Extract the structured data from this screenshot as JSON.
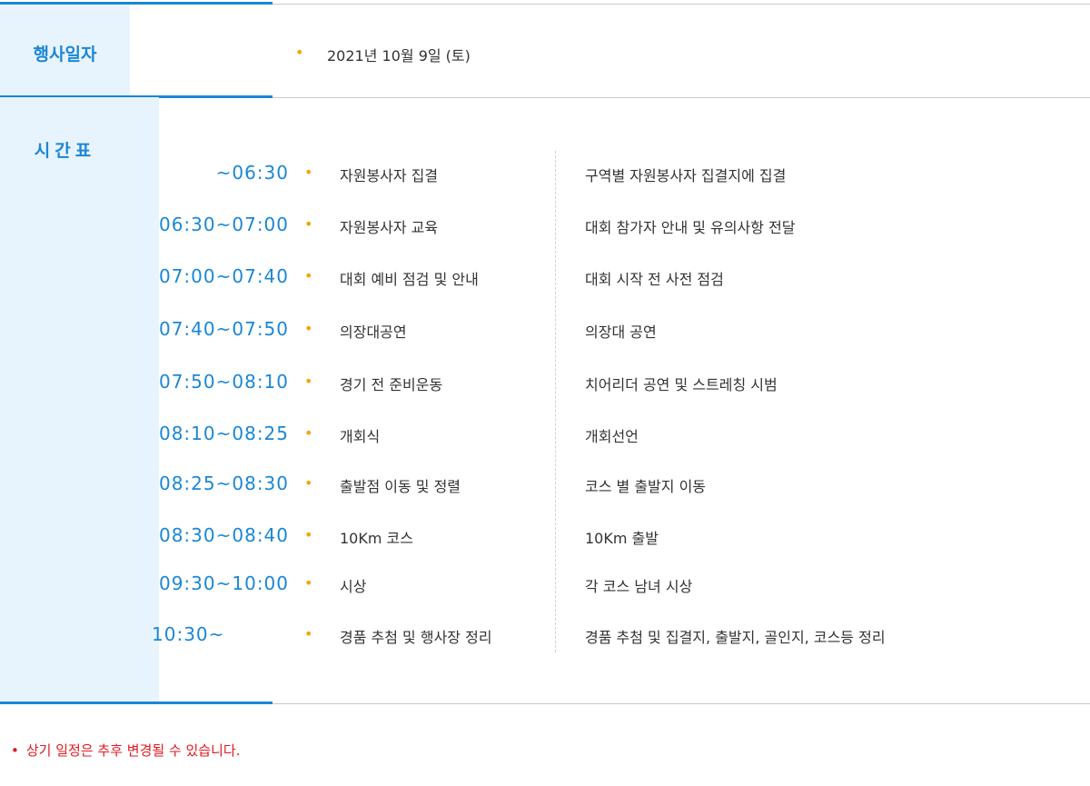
{
  "event_date": {
    "label": "행사일자",
    "value": "2021년 10월 9일 (토)"
  },
  "schedule": {
    "label": "시간표",
    "rows": [
      {
        "time": "~06:30",
        "activity": "자원봉사자 집결",
        "description": "구역별 자원봉사자 집결지에 집결"
      },
      {
        "time": "06:30~07:00",
        "activity": "자원봉사자 교육",
        "description": "대회 참가자 안내 및 유의사항 전달"
      },
      {
        "time": "07:00~07:40",
        "activity": "대회 예비 점검 및 안내",
        "description": "대회 시작 전 사전 점검"
      },
      {
        "time": "07:40~07:50",
        "activity": "의장대공연",
        "description": "의장대 공연"
      },
      {
        "time": "07:50~08:10",
        "activity": "경기 전 준비운동",
        "description": "치어리더 공연 및 스트레칭 시범"
      },
      {
        "time": "08:10~08:25",
        "activity": "개회식",
        "description": "개회선언"
      },
      {
        "time": "08:25~08:30",
        "activity": "출발점 이동 및 정렬",
        "description": "코스 별 출발지 이동"
      },
      {
        "time": "08:30~08:40",
        "activity": "10Km 코스",
        "description": "10Km 출발"
      },
      {
        "time": "09:30~10:00",
        "activity": "시상",
        "description": "각 코스 남녀 시상"
      },
      {
        "time": "10:30~",
        "activity": "경품 추첨 및 행사장 정리",
        "description": "경품 추첨 및 집결지, 출발지, 골인지, 코스등 정리"
      }
    ]
  },
  "note": {
    "bullet": "•",
    "text": "상기 일정은 추후 변경될 수 있습니다."
  },
  "colors": {
    "accent_blue": "#1a87d6",
    "label_background": "#e8f4fd",
    "bullet_orange": "#f5a300",
    "note_red": "#e0191f"
  }
}
